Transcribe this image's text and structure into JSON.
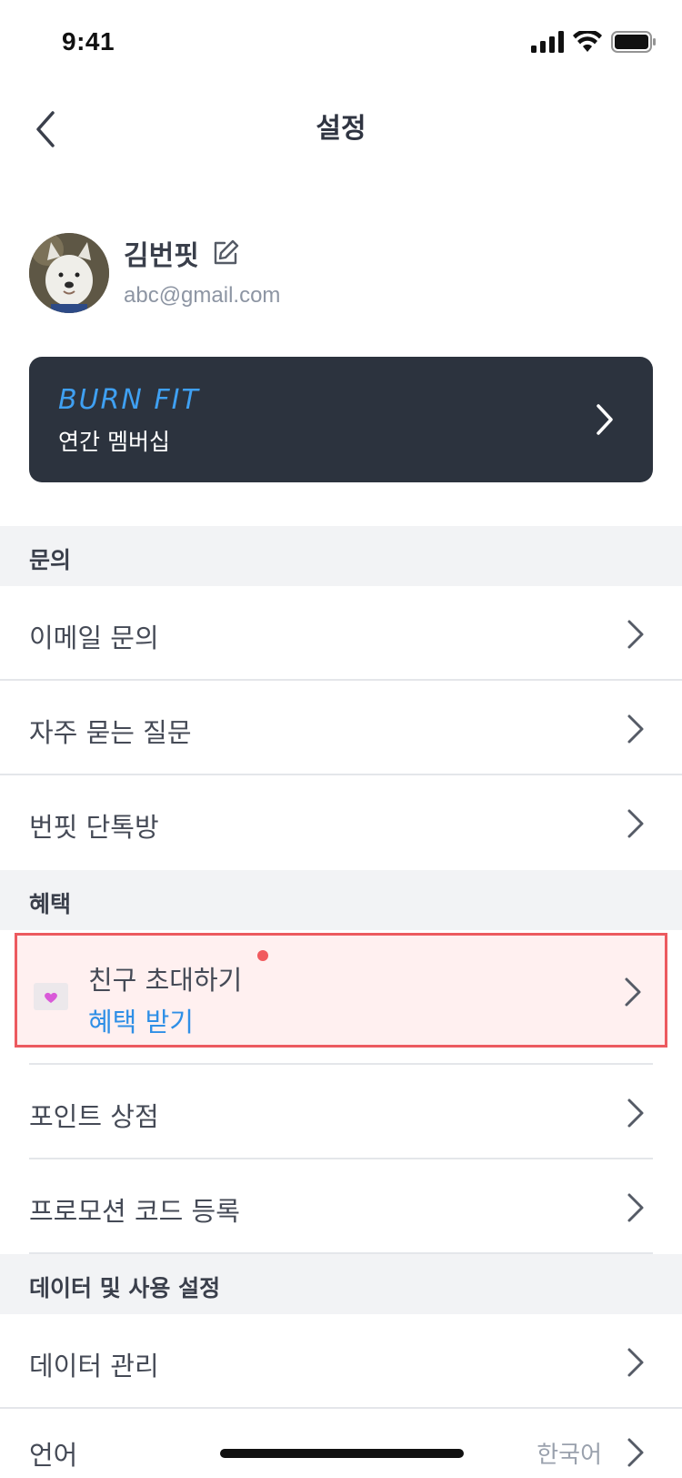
{
  "status_bar": {
    "time": "9:41"
  },
  "header": {
    "title": "설정"
  },
  "profile": {
    "name": "김번핏",
    "email": "abc@gmail.com"
  },
  "membership": {
    "brand": "BURN FIT",
    "label": "연간 멤버십"
  },
  "sections": {
    "inquiry": {
      "title": "문의",
      "items": [
        "이메일 문의",
        "자주 묻는 질문",
        "번핏 단톡방"
      ]
    },
    "benefits": {
      "title": "혜택",
      "invite": {
        "title": "친구 초대하기",
        "subtitle": "혜택 받기"
      },
      "items": [
        "포인트 상점",
        "프로모션 코드 등록"
      ]
    },
    "data_usage": {
      "title": "데이터 및 사용 설정",
      "items": [
        "데이터 관리",
        "언어"
      ],
      "language_value": "한국어"
    }
  },
  "colors": {
    "accent": "#2f8fe6",
    "card_bg": "#2c333e",
    "highlight_border": "#ec5a5f",
    "highlight_bg": "#fff0f0",
    "badge_dot": "#f15a5e"
  }
}
